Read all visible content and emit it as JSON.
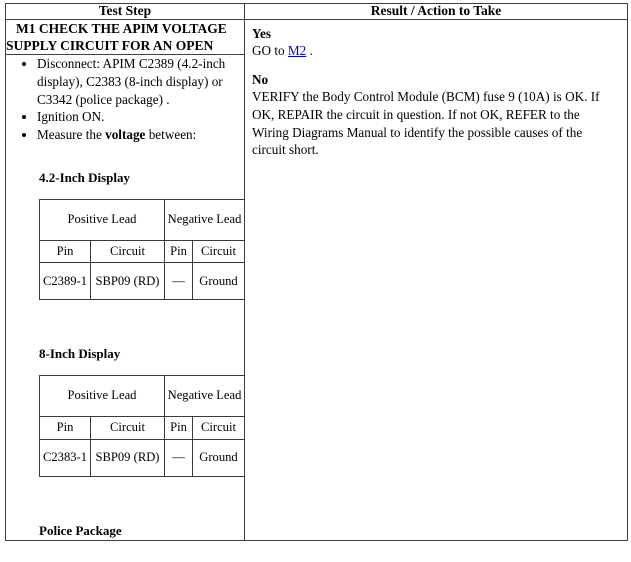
{
  "table": {
    "headers": {
      "step": "Test Step",
      "result": "Result / Action to Take"
    },
    "step_column": {
      "title_line1": "M1 CHECK THE APIM VOLTAGE",
      "title_line2": "SUPPLY CIRCUIT FOR AN OPEN",
      "bullets": [
        {
          "prefix": "Disconnect: APIM C2389 (4.2-inch display), C2383 (8-inch display) or C3342 (police package) .",
          "bold": "",
          "suffix": ""
        },
        {
          "prefix": "Ignition ON.",
          "bold": "",
          "suffix": ""
        },
        {
          "prefix": "Measure the ",
          "bold": "voltage",
          "suffix": " between:"
        }
      ],
      "sections": [
        {
          "heading": "4.2-Inch Display",
          "lead_table": {
            "group_headers": {
              "positive": "Positive Lead",
              "negative": "Negative Lead"
            },
            "sub_headers": {
              "positive_pin": "Pin",
              "positive_circuit": "Circuit",
              "negative_pin": "Pin",
              "negative_circuit": "Circuit"
            },
            "row": {
              "positive_pin": "C2389-1",
              "positive_circuit": "SBP09 (RD)",
              "negative_pin": "—",
              "negative_circuit": "Ground"
            }
          }
        },
        {
          "heading": "8-Inch Display",
          "lead_table": {
            "group_headers": {
              "positive": "Positive Lead",
              "negative": "Negative Lead"
            },
            "sub_headers": {
              "positive_pin": "Pin",
              "positive_circuit": "Circuit",
              "negative_pin": "Pin",
              "negative_circuit": "Circuit"
            },
            "row": {
              "positive_pin": "C2383-1",
              "positive_circuit": "SBP09 (RD)",
              "negative_pin": "—",
              "negative_circuit": "Ground"
            }
          }
        },
        {
          "heading": "Police Package"
        }
      ]
    },
    "result_column": {
      "yes_label": "Yes",
      "yes_text_before": "GO to ",
      "yes_link": "M2",
      "yes_text_after": " .",
      "no_label": "No",
      "no_text": "VERIFY the Body Control Module (BCM) fuse 9 (10A) is OK. If OK, REPAIR the circuit in question. If not OK, REFER to the Wiring Diagrams Manual to identify the possible causes of the circuit short."
    }
  },
  "colors": {
    "link": "#0000cc",
    "border": "#404040",
    "text": "#000000",
    "background": "#ffffff"
  }
}
